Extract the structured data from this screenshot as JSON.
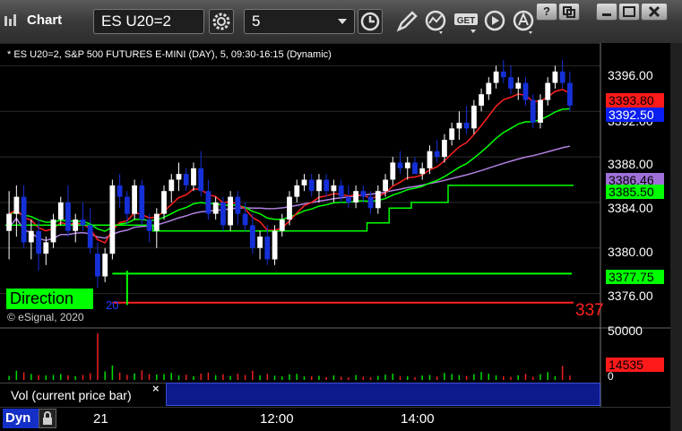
{
  "window": {
    "title": "Chart",
    "symbol_value": "ES U20=2",
    "interval_value": "5",
    "window_buttons": [
      "?",
      "",
      "",
      ""
    ]
  },
  "chart": {
    "title": "* ES U20=2, S&P 500 FUTURES E-MINI (DAY), 5, 09:30-16:15 (Dynamic)",
    "copyright": "© eSignal, 2020",
    "direction_label": "Direction",
    "price_ticks": [
      "3396.00",
      "3392.00",
      "3388.00",
      "3384.00",
      "3380.00",
      "3376.00"
    ],
    "price_tags": {
      "red": "3393.80",
      "blue": "3392.50",
      "purple": "3386.46",
      "green_line": "3385.50",
      "green_low": "3377.75",
      "red_edge": "337"
    },
    "low_marker": "20",
    "colors": {
      "up_candle": "#ffffff",
      "down_candle": "#1530d8",
      "ma_fast": "#ff2020",
      "ma_slow": "#00ff00",
      "vwap": "#b080e0",
      "stop_line": "#00ff00",
      "support_line": "#ff2020"
    }
  },
  "volume": {
    "label": "Vol (current price bar)",
    "close_glyph": "×",
    "top_tick": "50000",
    "current_tag": "14535",
    "zero_tick": "0"
  },
  "xaxis": {
    "mode": "Dyn",
    "labels": [
      "21",
      "12:00",
      "14:00"
    ]
  },
  "chart_data": {
    "type": "candlestick",
    "ylim": [
      3374,
      3398
    ],
    "candles": [
      [
        3381.5,
        3385,
        3379,
        3383
      ],
      [
        3383,
        3385.5,
        3381,
        3384.5
      ],
      [
        3384.5,
        3385.5,
        3380,
        3380.5
      ],
      [
        3380.5,
        3382.5,
        3379,
        3381.5
      ],
      [
        3381.5,
        3382.5,
        3378,
        3379.5
      ],
      [
        3379.5,
        3381,
        3378.5,
        3380.5
      ],
      [
        3380.5,
        3383,
        3380,
        3382.5
      ],
      [
        3382.5,
        3384.5,
        3382,
        3384
      ],
      [
        3384,
        3385.5,
        3381,
        3381.5
      ],
      [
        3381.5,
        3383,
        3380.5,
        3382.5
      ],
      [
        3382.5,
        3384,
        3381.5,
        3382
      ],
      [
        3382,
        3383.5,
        3379.5,
        3380
      ],
      [
        3379.5,
        3380.5,
        3376.5,
        3377.5
      ],
      [
        3377.5,
        3380,
        3377,
        3379.5
      ],
      [
        3379.5,
        3386,
        3379,
        3385.5
      ],
      [
        3385.5,
        3386.5,
        3383.5,
        3384.5
      ],
      [
        3384.5,
        3385,
        3382,
        3383
      ],
      [
        3383,
        3386,
        3382.5,
        3385.5
      ],
      [
        3385.5,
        3386,
        3382,
        3382.5
      ],
      [
        3382.5,
        3383,
        3380.5,
        3381.5
      ],
      [
        3381.5,
        3383.5,
        3380,
        3383
      ],
      [
        3383,
        3385.5,
        3382.5,
        3385
      ],
      [
        3385,
        3386.5,
        3384,
        3386
      ],
      [
        3386,
        3387.5,
        3385,
        3386.5
      ],
      [
        3386.5,
        3387,
        3385,
        3385.5
      ],
      [
        3385.5,
        3387.5,
        3385,
        3387
      ],
      [
        3387,
        3388.5,
        3384.5,
        3385
      ],
      [
        3385,
        3386,
        3382.5,
        3383
      ],
      [
        3383,
        3384.5,
        3382.5,
        3384
      ],
      [
        3384,
        3384.5,
        3381.5,
        3382
      ],
      [
        3382,
        3385,
        3381.5,
        3384.5
      ],
      [
        3384.5,
        3385,
        3382,
        3383
      ],
      [
        3383,
        3384,
        3381.5,
        3382
      ],
      [
        3382,
        3383,
        3379.5,
        3380
      ],
      [
        3380,
        3381.5,
        3379,
        3381
      ],
      [
        3381,
        3382,
        3378.5,
        3379
      ],
      [
        3379,
        3382,
        3378.5,
        3381.5
      ],
      [
        3381.5,
        3383,
        3381,
        3382.5
      ],
      [
        3382.5,
        3385,
        3382,
        3384.5
      ],
      [
        3384.5,
        3386,
        3384,
        3385.5
      ],
      [
        3385.5,
        3386.5,
        3385,
        3386
      ],
      [
        3386,
        3386.5,
        3384.5,
        3385
      ],
      [
        3385,
        3386.5,
        3384,
        3386
      ],
      [
        3386,
        3386.5,
        3384.5,
        3385
      ],
      [
        3385,
        3386,
        3384,
        3385.5
      ],
      [
        3385.5,
        3386,
        3384,
        3384.5
      ],
      [
        3384.5,
        3385.5,
        3383.5,
        3384
      ],
      [
        3384,
        3385.5,
        3383.5,
        3385
      ],
      [
        3385,
        3385.5,
        3384,
        3384.5
      ],
      [
        3384.5,
        3385,
        3383,
        3383.5
      ],
      [
        3383.5,
        3385.5,
        3383,
        3385
      ],
      [
        3385,
        3386.5,
        3384.5,
        3386
      ],
      [
        3386,
        3388,
        3385.5,
        3387.5
      ],
      [
        3387.5,
        3388.5,
        3386.5,
        3387
      ],
      [
        3387,
        3388,
        3386,
        3387.5
      ],
      [
        3387.5,
        3388,
        3386.5,
        3386.5
      ],
      [
        3386.5,
        3387.5,
        3386,
        3387
      ],
      [
        3387,
        3389,
        3386.5,
        3388.5
      ],
      [
        3388.5,
        3389.5,
        3387.5,
        3388
      ],
      [
        3388,
        3390,
        3387.5,
        3389.5
      ],
      [
        3389.5,
        3391,
        3389,
        3390.5
      ],
      [
        3390.5,
        3392,
        3389.5,
        3391
      ],
      [
        3391,
        3392.5,
        3390,
        3390.5
      ],
      [
        3390.5,
        3393,
        3390,
        3392.5
      ],
      [
        3392.5,
        3394,
        3392,
        3393.5
      ],
      [
        3393.5,
        3395,
        3393,
        3394.5
      ],
      [
        3394.5,
        3396,
        3394,
        3395.5
      ],
      [
        3395.5,
        3396.5,
        3394.5,
        3395
      ],
      [
        3395,
        3396,
        3393.5,
        3394
      ],
      [
        3394,
        3395,
        3393,
        3394.5
      ],
      [
        3394.5,
        3395,
        3392.5,
        3393
      ],
      [
        3393,
        3393.5,
        3390.5,
        3391
      ],
      [
        3391,
        3393.5,
        3390.5,
        3393
      ],
      [
        3393,
        3395,
        3392.5,
        3394.5
      ],
      [
        3394.5,
        3396,
        3394,
        3395.5
      ],
      [
        3395.5,
        3396.5,
        3394,
        3394.5
      ],
      [
        3394.5,
        3395.5,
        3392,
        3392.5
      ]
    ],
    "volume_ylim": [
      0,
      50000
    ],
    "volume": [
      4200,
      9500,
      7800,
      6200,
      5100,
      4600,
      5300,
      6100,
      4800,
      3900,
      5200,
      6900,
      48000,
      8800,
      15000,
      7700,
      5200,
      6800,
      9900,
      6200,
      5600,
      6100,
      7300,
      4800,
      5400,
      3800,
      6600,
      7700,
      4900,
      5800,
      4100,
      6400,
      5200,
      9400,
      4700,
      6200,
      4400,
      3500,
      5800,
      6300,
      3700,
      3900,
      4300,
      2900,
      4600,
      3300,
      2600,
      5100,
      3200,
      2800,
      4200,
      5500,
      6600,
      4100,
      3900,
      2700,
      4500,
      5100,
      3600,
      7200,
      6100,
      5000,
      4200,
      5900,
      8300,
      6400,
      4700,
      3800,
      3200,
      4800,
      6100,
      3300,
      5900,
      8100,
      3900,
      14535,
      4500
    ]
  }
}
